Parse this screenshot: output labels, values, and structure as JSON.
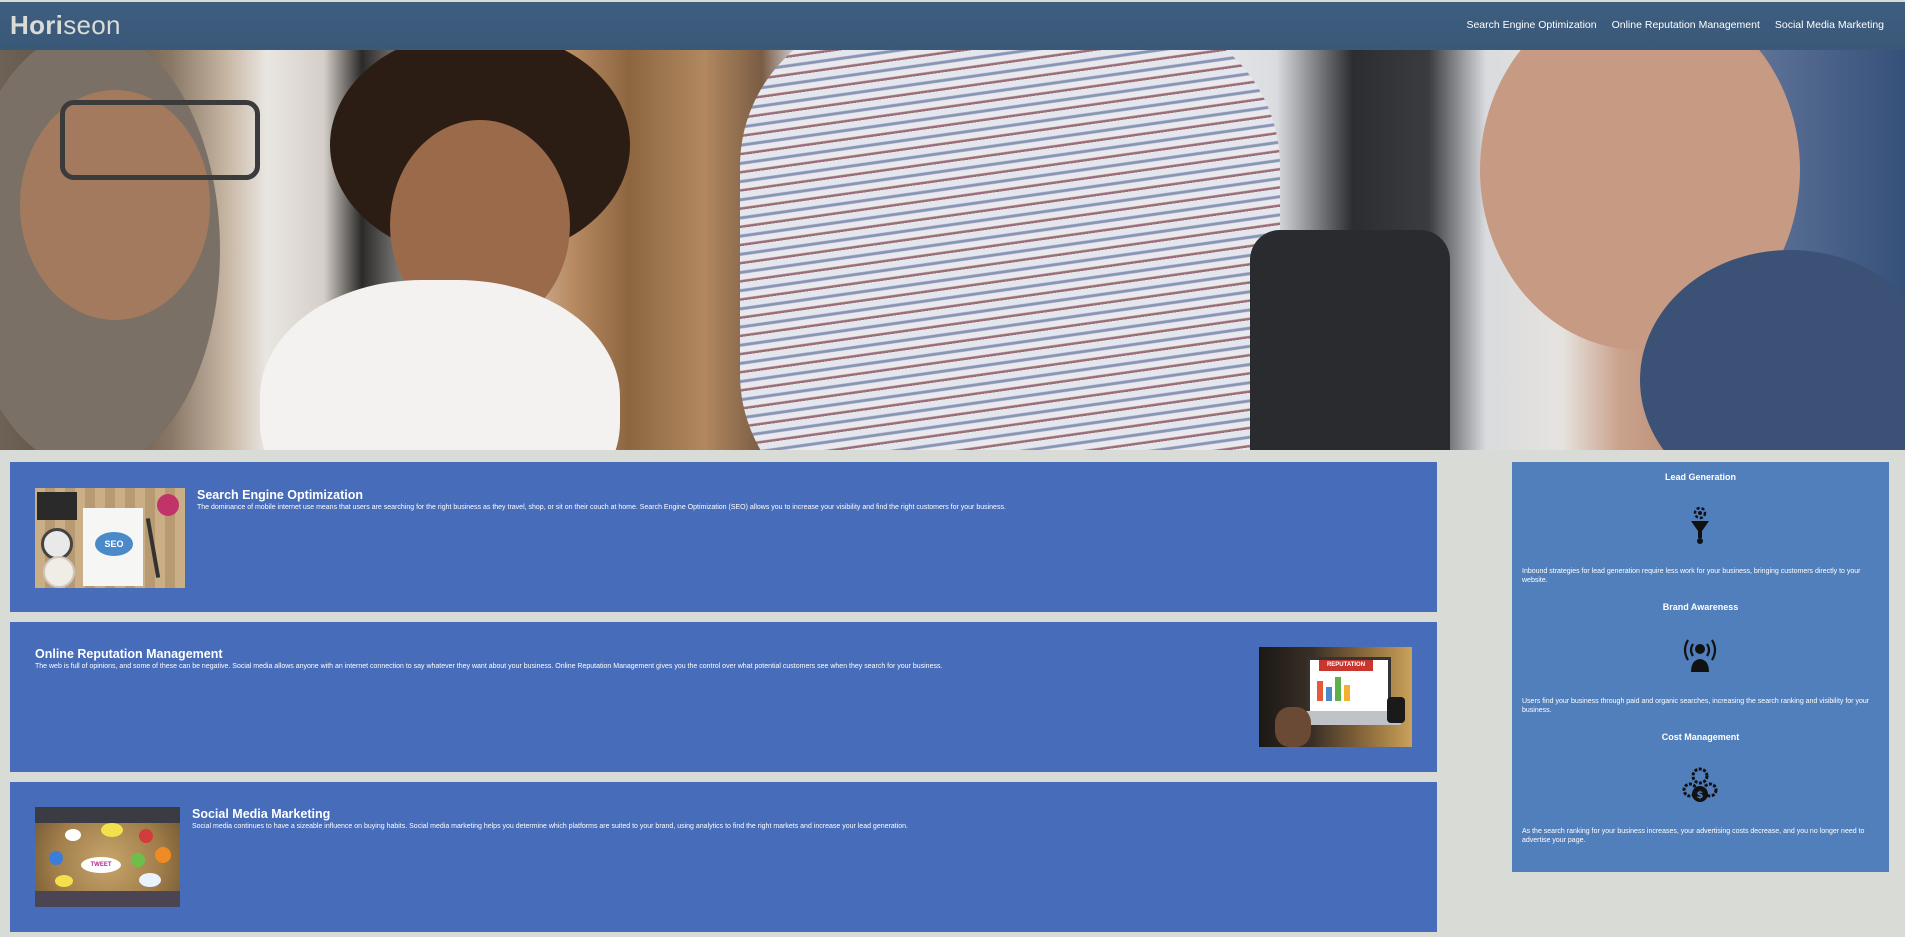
{
  "header": {
    "logo_part1": "Hori",
    "logo_part2": "seon",
    "nav": [
      "Search Engine Optimization",
      "Online Reputation Management",
      "Social Media Marketing"
    ]
  },
  "content": [
    {
      "title": "Search Engine Optimization",
      "text": "The dominance of mobile internet use means that users are searching for the right business as they travel, shop, or sit on their couch at home. Search Engine Optimization (SEO) allows you to increase your visibility and find the right customers for your business."
    },
    {
      "title": "Online Reputation Management",
      "text": "The web is full of opinions, and some of these can be negative. Social media allows anyone with an internet connection to say whatever they want about your business. Online Reputation Management gives you the control over what potential customers see when they search for your business."
    },
    {
      "title": "Social Media Marketing",
      "text": "Social media continues to have a sizeable influence on buying habits. Social media marketing helps you determine which platforms are suited to your brand, using analytics to find the right markets and increase your lead generation."
    }
  ],
  "benefits": [
    {
      "title": "Lead Generation",
      "icon": "lead-funnel-icon",
      "text": "Inbound strategies for lead generation require less work for your business, bringing customers directly to your website."
    },
    {
      "title": "Brand Awareness",
      "icon": "brand-broadcast-icon",
      "text": "Users find your business through paid and organic searches, increasing the search ranking and visibility for your business."
    },
    {
      "title": "Cost Management",
      "icon": "cost-gears-icon",
      "text": "As the search ranking for your business increases, your advertising costs decrease, and you no longer need to advertise your page."
    }
  ],
  "thumb_text": {
    "seo": "SEO",
    "reputation": "REPUTATION",
    "tweet": "TWEET"
  },
  "colors": {
    "header": "#3b5a7c",
    "content_block": "#466cba",
    "sidebar": "#517fbb",
    "page_bg": "#d9dcd6"
  }
}
